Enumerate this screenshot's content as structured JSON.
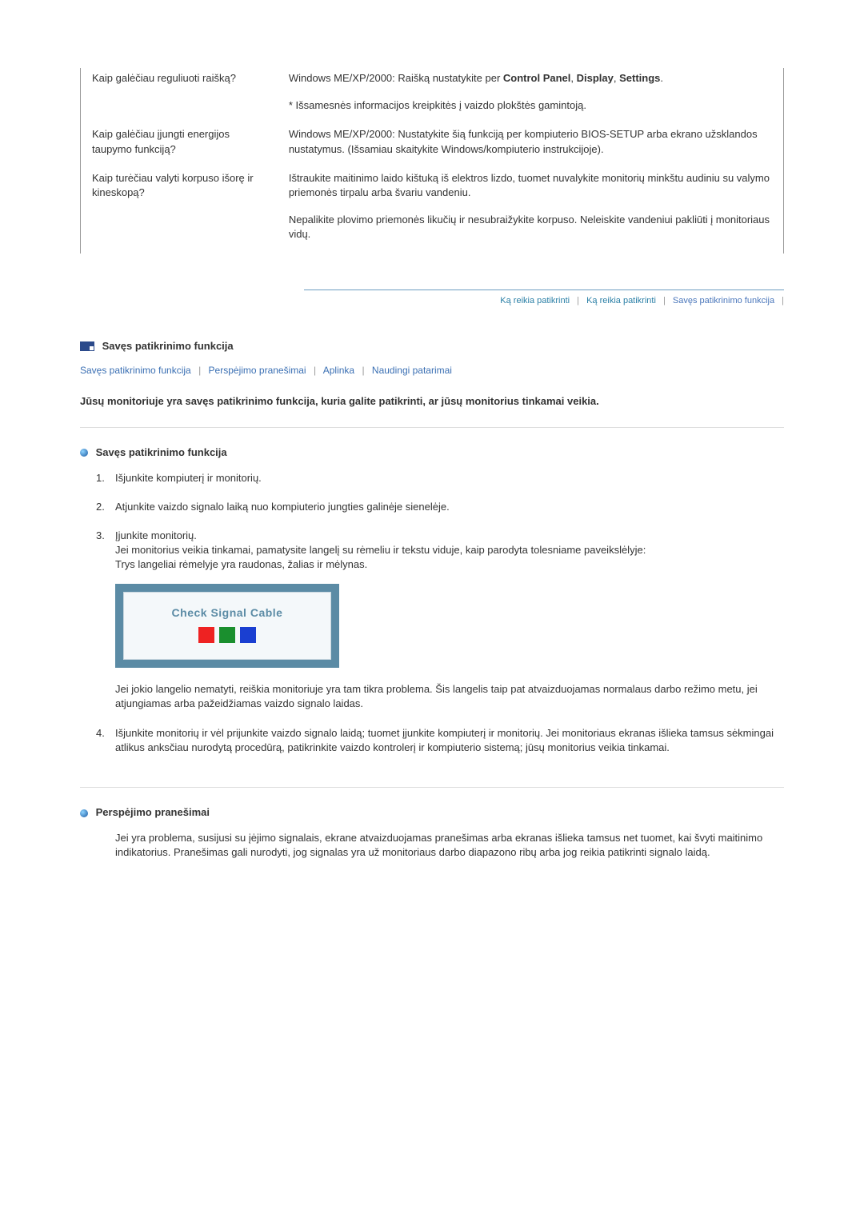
{
  "faq": {
    "rows": [
      {
        "q": "Kaip galėčiau reguliuoti raišką?",
        "a": [
          {
            "pre": "Windows ME/XP/2000: Raišką nustatykite per ",
            "bold": "Control Panel",
            "mid": ", ",
            "bold2": "Display",
            "mid2": ", ",
            "bold3": "Settings",
            "post": "."
          },
          "* Išsamesnės informacijos kreipkitės į vaizdo plokštės gamintoją."
        ]
      },
      {
        "q": "Kaip galėčiau įjungti energijos taupymo funkciją?",
        "a": [
          "Windows ME/XP/2000: Nustatykite šią funkciją per kompiuterio BIOS-SETUP arba ekrano užsklandos nustatymus. (Išsamiau skaitykite Windows/kompiuterio instrukcijoje)."
        ]
      },
      {
        "q": "Kaip turėčiau valyti korpuso išorę ir kineskopą?",
        "a": [
          "Ištraukite maitinimo laido kištuką iš elektros lizdo, tuomet nuvalykite monitorių minkštu audiniu su valymo priemonės tirpalu arba švariu vandeniu.",
          "Nepalikite plovimo priemonės likučių ir nesubraižykite korpuso. Neleiskite vandeniui pakliūti į monitoriaus vidų."
        ]
      }
    ]
  },
  "tabs": {
    "items": [
      "Ką reikia patikrinti",
      "Ką reikia patikrinti",
      "Savęs patikrinimo funkcija"
    ]
  },
  "section": {
    "title": "Savęs patikrinimo funkcija",
    "links": [
      "Savęs patikrinimo funkcija",
      "Perspėjimo pranešimai",
      "Aplinka",
      "Naudingi patarimai"
    ],
    "intro": "Jūsų monitoriuje yra savęs patikrinimo funkcija, kuria galite patikrinti, ar jūsų monitorius tinkamai veikia."
  },
  "selfcheck": {
    "heading": "Savęs patikrinimo funkcija",
    "steps": [
      "Išjunkite kompiuterį ir monitorių.",
      "Atjunkite vaizdo signalo laiką nuo kompiuterio jungties galinėje sienelėje.",
      {
        "line1": "Įjunkite monitorių.",
        "line2": "Jei monitorius veikia tinkamai, pamatysite langelį su rėmeliu ir tekstu viduje, kaip parodyta tolesniame paveikslėlyje:",
        "line3": "Trys langeliai rėmelyje yra raudonas, žalias ir mėlynas.",
        "signal_label": "Check Signal Cable",
        "after": "Jei jokio langelio nematyti, reiškia monitoriuje yra tam tikra problema. Šis langelis taip pat atvaizduojamas normalaus darbo režimo metu, jei atjungiamas arba pažeidžiamas vaizdo signalo laidas."
      },
      "Išjunkite monitorių ir vėl prijunkite vaizdo signalo laidą; tuomet įjunkite kompiuterį ir monitorių. Jei monitoriaus ekranas išlieka tamsus sėkmingai atlikus anksčiau nurodytą procedūrą, patikrinkite vaizdo kontrolerį ir kompiuterio sistemą; jūsų monitorius veikia tinkamai."
    ]
  },
  "warn": {
    "heading": "Perspėjimo pranešimai",
    "body": "Jei yra problema, susijusi su įėjimo signalais, ekrane atvaizduojamas pranešimas arba ekranas išlieka tamsus net tuomet, kai švyti maitinimo indikatorius. Pranešimas gali nurodyti, jog signalas yra už monitoriaus darbo diapazono ribų arba jog reikia patikrinti signalo laidą."
  }
}
